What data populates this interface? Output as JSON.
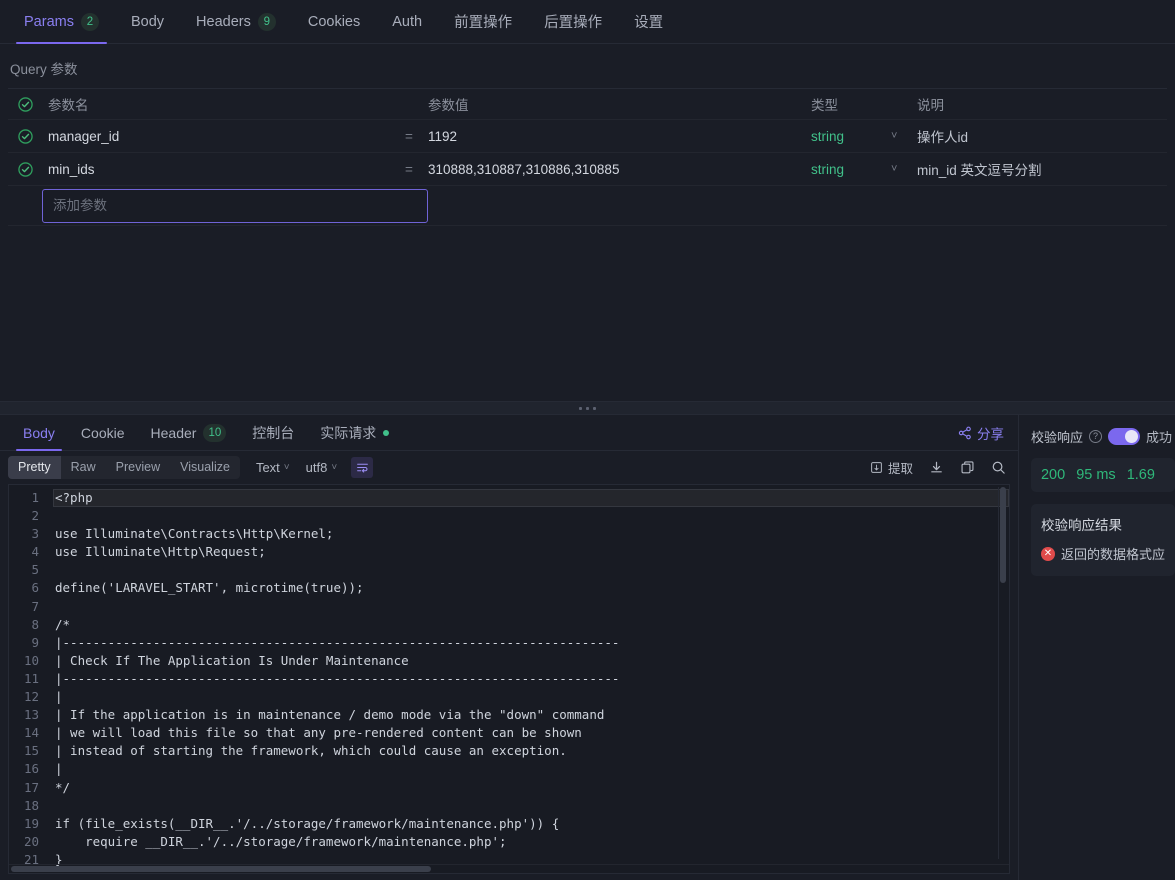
{
  "request_tabs": [
    {
      "label": "Params",
      "badge": "2",
      "active": true
    },
    {
      "label": "Body",
      "badge": "",
      "active": false
    },
    {
      "label": "Headers",
      "badge": "9",
      "active": false
    },
    {
      "label": "Cookies",
      "badge": "",
      "active": false
    },
    {
      "label": "Auth",
      "badge": "",
      "active": false
    },
    {
      "label": "前置操作",
      "badge": "",
      "active": false
    },
    {
      "label": "后置操作",
      "badge": "",
      "active": false
    },
    {
      "label": "设置",
      "badge": "",
      "active": false
    }
  ],
  "params": {
    "section_label": "Query 参数",
    "columns": {
      "name": "参数名",
      "value": "参数值",
      "type": "类型",
      "desc": "说明"
    },
    "rows": [
      {
        "checked": true,
        "name": "manager_id",
        "eq": "=",
        "value": "1192",
        "type": "string",
        "desc": "操作人id"
      },
      {
        "checked": true,
        "name": "min_ids",
        "eq": "=",
        "value": "310888,310887,310886,310885",
        "type": "string",
        "desc": "min_id 英文逗号分割"
      }
    ],
    "add_placeholder": "添加参数"
  },
  "response_tabs": [
    {
      "label": "Body",
      "badge": "",
      "dot": false,
      "active": true
    },
    {
      "label": "Cookie",
      "badge": "",
      "dot": false,
      "active": false
    },
    {
      "label": "Header",
      "badge": "10",
      "dot": false,
      "active": false
    },
    {
      "label": "控制台",
      "badge": "",
      "dot": false,
      "active": false
    },
    {
      "label": "实际请求",
      "badge": "",
      "dot": true,
      "active": false
    }
  ],
  "share_label": "分享",
  "body_toolbar": {
    "views": [
      {
        "label": "Pretty",
        "active": true
      },
      {
        "label": "Raw",
        "active": false
      },
      {
        "label": "Preview",
        "active": false
      },
      {
        "label": "Visualize",
        "active": false
      }
    ],
    "format_select": "Text",
    "encoding_select": "utf8",
    "extract_label": "提取"
  },
  "code": {
    "lines": [
      {
        "n": "1",
        "text": "<?php",
        "hl": true
      },
      {
        "n": "2",
        "text": "",
        "hl": false
      },
      {
        "n": "3",
        "text": "use Illuminate\\Contracts\\Http\\Kernel;",
        "hl": false
      },
      {
        "n": "4",
        "text": "use Illuminate\\Http\\Request;",
        "hl": false
      },
      {
        "n": "5",
        "text": "",
        "hl": false
      },
      {
        "n": "6",
        "text": "define('LARAVEL_START', microtime(true));",
        "hl": false
      },
      {
        "n": "7",
        "text": "",
        "hl": false
      },
      {
        "n": "8",
        "text": "/*",
        "hl": false
      },
      {
        "n": "9",
        "text": "|--------------------------------------------------------------------------",
        "hl": false
      },
      {
        "n": "10",
        "text": "| Check If The Application Is Under Maintenance",
        "hl": false
      },
      {
        "n": "11",
        "text": "|--------------------------------------------------------------------------",
        "hl": false
      },
      {
        "n": "12",
        "text": "|",
        "hl": false
      },
      {
        "n": "13",
        "text": "| If the application is in maintenance / demo mode via the \"down\" command",
        "hl": false
      },
      {
        "n": "14",
        "text": "| we will load this file so that any pre-rendered content can be shown",
        "hl": false
      },
      {
        "n": "15",
        "text": "| instead of starting the framework, which could cause an exception.",
        "hl": false
      },
      {
        "n": "16",
        "text": "|",
        "hl": false
      },
      {
        "n": "17",
        "text": "*/",
        "hl": false
      },
      {
        "n": "18",
        "text": "",
        "hl": false
      },
      {
        "n": "19",
        "text": "if (file_exists(__DIR__.'/../storage/framework/maintenance.php')) {",
        "hl": false
      },
      {
        "n": "20",
        "text": "    require __DIR__.'/../storage/framework/maintenance.php';",
        "hl": false
      },
      {
        "n": "21",
        "text": "}",
        "hl": false
      }
    ]
  },
  "verify": {
    "title": "校验响应",
    "status_suffix": "成功",
    "stats": {
      "status_code": "200",
      "time": "95 ms",
      "size": "1.69"
    },
    "result_title": "校验响应结果",
    "result_message": "返回的数据格式应"
  },
  "colors": {
    "accent": "#7b68ee",
    "accent_text": "#8a7ff0",
    "success": "#41c08a",
    "error": "#e04b4b",
    "background": "#1a1d26",
    "panel": "#20242e",
    "code_bg": "#181b23"
  }
}
